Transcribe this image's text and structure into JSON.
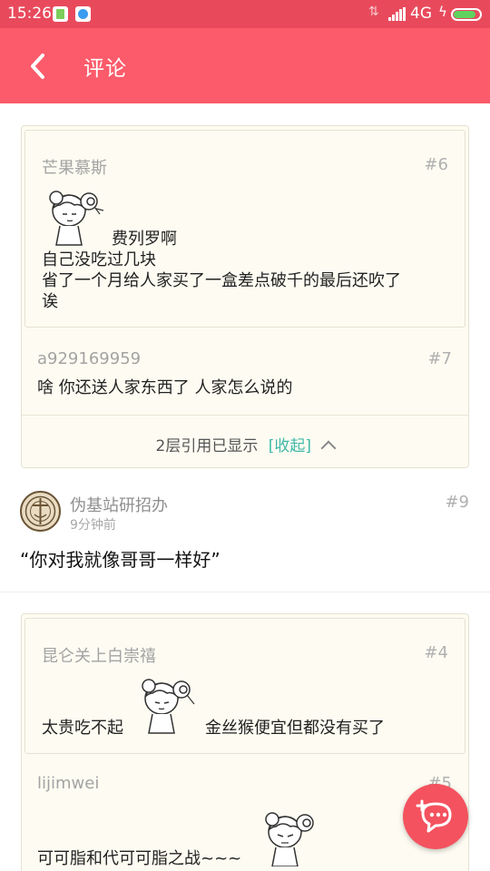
{
  "status_bar": {
    "time": "15:26",
    "network": "4G",
    "signal_icon": "signal-icon",
    "battery_icon": "battery-icon",
    "battery_level": 0.85
  },
  "header": {
    "title": "评论",
    "back_icon": "back-arrow-icon"
  },
  "comments": [
    {
      "quotes": [
        {
          "user": "芒果慕斯",
          "floor": "#6",
          "text_line1": "费列罗啊",
          "text_line2": "自己没吃过几块",
          "text_line3": "省了一个月给人家买了一盒差点破千的最后还吹了",
          "text_line4": "诶"
        },
        {
          "user": "a929169959",
          "floor": "#7",
          "text": "啥 你还送人家东西了 人家怎么说的"
        }
      ],
      "quote_status": "2层引用已显示",
      "collapse_label": "[收起]",
      "user": "伪基站研招办",
      "time_ago": "9分钟前",
      "floor": "#9",
      "text": "“你对我就像哥哥一样好”"
    },
    {
      "quotes": [
        {
          "user": "昆仑关上白崇禧",
          "floor": "#4",
          "text_before": "太贵吃不起",
          "text_after": "金丝猴便宜但都没有买了"
        },
        {
          "user": "lijimwei",
          "floor": "#5",
          "text": "可可脂和代可可脂之战~~~"
        }
      ]
    }
  ],
  "fab_icon": "add-comment-icon",
  "colors": {
    "status_bar": "#e84a5c",
    "header": "#fb5b6a",
    "quote_bg": "#fefcf2",
    "link": "#3fb8a8",
    "fab": "#f4525f"
  }
}
